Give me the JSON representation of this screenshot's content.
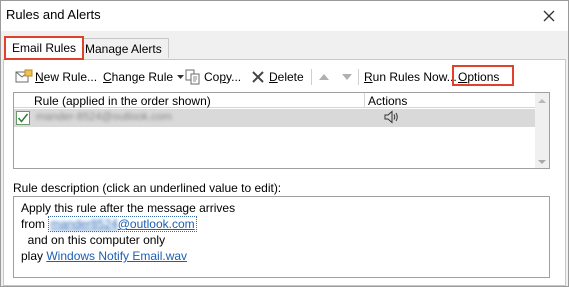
{
  "window": {
    "title": "Rules and Alerts"
  },
  "tabs": [
    {
      "label": "Email Rules",
      "active": true
    },
    {
      "label": "Manage Alerts",
      "active": false
    }
  ],
  "toolbar": {
    "new_rule": {
      "accel": "N",
      "rest": "ew Rule..."
    },
    "change_rule": {
      "accel": "C",
      "rest": "hange Rule"
    },
    "copy": {
      "pre": "Co",
      "accel": "p",
      "rest": "y..."
    },
    "delete": {
      "accel": "D",
      "rest": "elete"
    },
    "run_rules": {
      "accel": "R",
      "rest": "un Rules Now..."
    },
    "options": {
      "accel": "O",
      "rest": "ptions"
    }
  },
  "rules_list": {
    "headers": {
      "rule": "Rule (applied in the order shown)",
      "actions": "Actions"
    },
    "rows": [
      {
        "checked": true,
        "name": "mander-8524@outlook.com",
        "action_icon": "speaker-icon"
      }
    ]
  },
  "description": {
    "label": "Rule description (click an underlined value to edit):",
    "line1": "Apply this rule after the message arrives",
    "line2_prefix": "from",
    "line2_blurred": "mander8524",
    "line2_domain": "@outlook.com",
    "line3": "  and on this computer only",
    "line4_prefix": "play",
    "line4_link": "Windows Notify Email.wav"
  },
  "colors": {
    "highlight_border": "#e0412a",
    "link": "#1a5fb4",
    "selected_row": "#d9d9d9"
  }
}
